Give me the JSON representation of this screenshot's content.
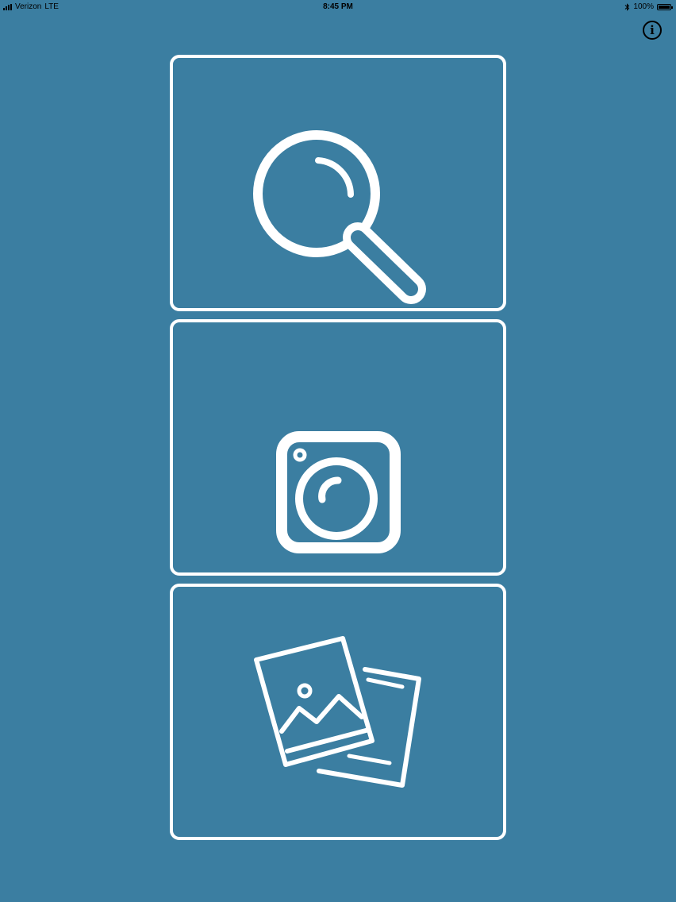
{
  "status_bar": {
    "carrier": "Verizon",
    "network": "LTE",
    "time": "8:45 PM",
    "battery": "100%",
    "battery_level": 1.0,
    "icons": [
      "signal-icon",
      "bluetooth-icon",
      "battery-icon"
    ]
  },
  "header": {
    "info_icon": "info-icon",
    "info_glyph": "i"
  },
  "tiles": [
    {
      "name": "search",
      "icon": "magnifying-glass-icon"
    },
    {
      "name": "camera",
      "icon": "camera-icon"
    },
    {
      "name": "photos",
      "icon": "photo-library-icon"
    }
  ],
  "colors": {
    "background": "#3b7ea1",
    "foreground": "#ffffff"
  }
}
